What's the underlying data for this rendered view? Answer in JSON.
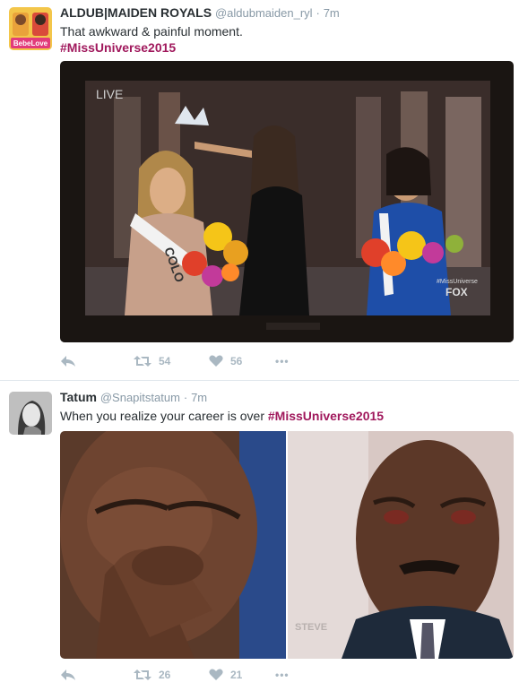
{
  "tweets": [
    {
      "name": "ALDUB|MAIDEN ROYALS",
      "handle": "@aldubmaiden_ryl",
      "separator": "·",
      "time": "7m",
      "text_line1": "That awkward & painful moment.",
      "hashtag": "#MissUniverse2015",
      "avatar_text": "BebeLove",
      "media_overlay_live": "LIVE",
      "media_overlay_sash": "COLO",
      "media_overlay_tag": "#MissUniverse",
      "media_overlay_network": "FOX",
      "retweets": "54",
      "likes": "56",
      "more": "•••"
    },
    {
      "name": "Tatum",
      "handle": "@Snapitstatum",
      "separator": "·",
      "time": "7m",
      "text_prefix": "When you realize your career is over ",
      "hashtag": "#MissUniverse2015",
      "media_overlay_logo": "STEVE",
      "retweets": "26",
      "likes": "21",
      "more": "•••"
    }
  ],
  "colors": {
    "hashtag": "#a0185c",
    "action_icon": "#aab8c2",
    "meta": "#8899a6"
  },
  "icons": [
    "reply-icon",
    "retweet-icon",
    "heart-icon",
    "more-icon"
  ]
}
